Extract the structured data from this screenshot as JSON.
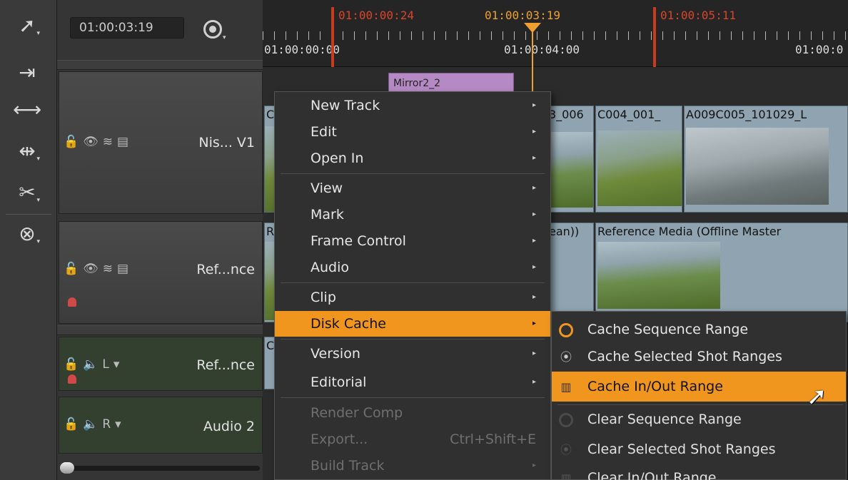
{
  "toolbar": {
    "tools": [
      {
        "name": "select-tool-icon",
        "glyph": "➚"
      },
      {
        "name": "track-select-icon",
        "glyph": "⇥"
      },
      {
        "name": "ripple-icon",
        "glyph": "⟷"
      },
      {
        "name": "slip-icon",
        "glyph": "⇹"
      },
      {
        "name": "razor-icon",
        "glyph": "✂"
      },
      {
        "name": "multi-view-icon",
        "glyph": "⊗"
      }
    ]
  },
  "header": {
    "timecode": "01:00:03:19"
  },
  "ruler": {
    "in_marker": "01:00:00:24",
    "playhead": "01:00:03:19",
    "out_marker": "01:00:05:11",
    "label_start": "01:00:00:00",
    "label_mid": "01:00:04:00",
    "label_end": "01:00:0"
  },
  "tracks": {
    "video1": {
      "name": "Nis... V1"
    },
    "reference": {
      "name": "Ref...nce"
    },
    "audio1": {
      "name": "Ref...nce",
      "channel": "L"
    },
    "audio2": {
      "name": "Audio 2",
      "channel": "R"
    }
  },
  "clips": {
    "effect": "Mirror2_2",
    "v1_partial_left": "C",
    "v1_clip_b": "3_006",
    "v1_clip_c": "C004_001_",
    "v1_clip_d": "A009C005_101029_L",
    "ref_partial_left": "R",
    "ref_clip_a": "ean))",
    "ref_clip_b": "Reference Media (Offline Master",
    "audio_partial": "C"
  },
  "context_menu": {
    "items": [
      {
        "label": "New Track",
        "submenu": true
      },
      {
        "label": "Edit",
        "submenu": true
      },
      {
        "label": "Open In",
        "submenu": true
      },
      {
        "label": "View",
        "submenu": true
      },
      {
        "label": "Mark",
        "submenu": true
      },
      {
        "label": "Frame Control",
        "submenu": true
      },
      {
        "label": "Audio",
        "submenu": true
      },
      {
        "label": "Clip",
        "submenu": true
      },
      {
        "label": "Disk Cache",
        "submenu": true
      },
      {
        "label": "Version",
        "submenu": true
      },
      {
        "label": "Editorial",
        "submenu": true
      },
      {
        "label": "Render Comp"
      },
      {
        "label": "Export...",
        "shortcut": "Ctrl+Shift+E"
      },
      {
        "label": "Build Track",
        "submenu": true
      }
    ]
  },
  "disk_cache_submenu": {
    "items": [
      {
        "label": "Cache Sequence Range"
      },
      {
        "label": "Cache Selected Shot Ranges"
      },
      {
        "label": "Cache In/Out Range"
      },
      {
        "label": "Clear Sequence Range"
      },
      {
        "label": "Clear Selected Shot Ranges"
      },
      {
        "label": "Clear In/Out Range"
      }
    ]
  },
  "colors": {
    "accent": "#f0961e",
    "marker": "#c73c1f",
    "playhead": "#f0a030",
    "clip": "#8fa4b0",
    "effect": "#b58ac4"
  }
}
